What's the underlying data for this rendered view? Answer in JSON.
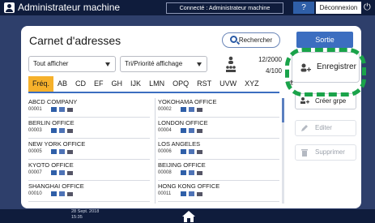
{
  "topbar": {
    "title": "Administrateur machine",
    "connection": "Connecté : Administrateur machine",
    "help_label": "?",
    "logout_label": "Déconnexion",
    "power_glyph": "⏻"
  },
  "panel": {
    "title": "Carnet d'adresses",
    "search_label": "Rechercher",
    "exit_label": "Sortie"
  },
  "filters": {
    "show_value": "Tout afficher",
    "sort_value": "Tri/Priorité affichage",
    "count_line1": "12/2000",
    "count_line2": "4/100"
  },
  "tabs": [
    "Fréq.",
    "AB",
    "CD",
    "EF",
    "GH",
    "IJK",
    "LMN",
    "OPQ",
    "RST",
    "UVW",
    "XYZ"
  ],
  "entries": [
    {
      "name": "ABCD COMPANY",
      "num": "00001"
    },
    {
      "name": "YOKOHAMA OFFICE",
      "num": "00002"
    },
    {
      "name": "BERLIN OFFICE",
      "num": "00003"
    },
    {
      "name": "LONDON OFFICE",
      "num": "00004"
    },
    {
      "name": "NEW YORK OFFICE",
      "num": "00005"
    },
    {
      "name": "LOS ANGELES",
      "num": "00006"
    },
    {
      "name": "KYOTO OFFICE",
      "num": "00007"
    },
    {
      "name": "BEIJING OFFICE",
      "num": "00008"
    },
    {
      "name": "SHANGHAI OFFICE",
      "num": "00010"
    },
    {
      "name": "HONG KONG OFFICE",
      "num": "00011"
    }
  ],
  "side": {
    "register_label": "Enregistrer",
    "create_group_label": "Créer grpe",
    "edit_label": "Editer",
    "delete_label": "Supprimer"
  },
  "bottom": {
    "date": "28 Sept. 2018",
    "time": "15:35"
  },
  "colors": {
    "accent": "#3c6ec0",
    "active_tab": "#f6b12b",
    "highlight": "#1aa34a",
    "topbar": "#0f1c3c"
  }
}
